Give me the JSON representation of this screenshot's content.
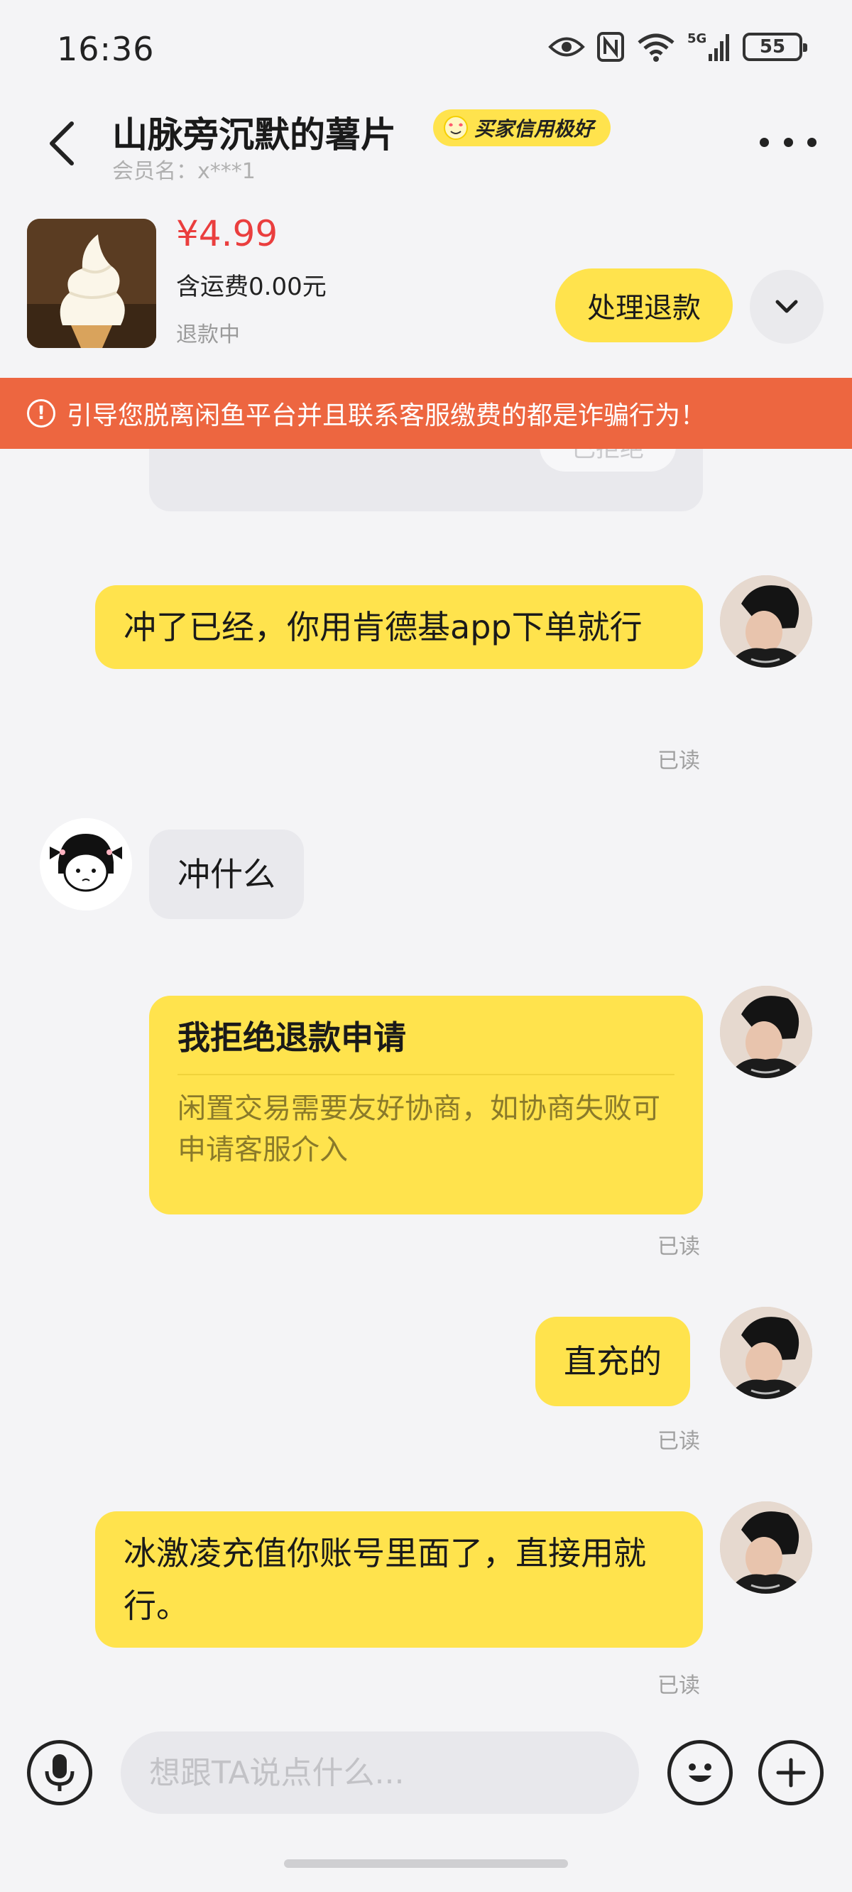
{
  "status_bar": {
    "time": "16:36",
    "network": "5G",
    "battery": "55",
    "icons": [
      "eye-icon",
      "nfc-icon",
      "wifi-icon",
      "signal-icon",
      "battery-icon"
    ]
  },
  "header": {
    "seller_name": "山脉旁沉默的薯片",
    "credit_badge": "买家信用极好",
    "member_id": "会员名：x***1"
  },
  "product": {
    "price": "¥4.99",
    "shipping": "含运费0.00元",
    "status": "退款中",
    "refund_button": "处理退款"
  },
  "warning": {
    "text": "引导您脱离闲鱼平台并且联系客服缴费的都是诈骗行为！"
  },
  "messages": [
    {
      "from": "me",
      "text": "冲了已经，你用肯德基app下单就行",
      "read": "已读"
    },
    {
      "from": "other",
      "text": "冲什么"
    },
    {
      "from": "me",
      "type": "card",
      "title": "我拒绝退款申请",
      "body": "闲置交易需要友好协商，如协商失败可申请客服介入",
      "read": "已读"
    },
    {
      "from": "me",
      "text": "直充的",
      "read": "已读"
    },
    {
      "from": "me",
      "text": "冰激凌充值你账号里面了，直接用就行。",
      "read": "已读"
    }
  ],
  "partial_card": {
    "button_text": "已拒绝"
  },
  "input": {
    "placeholder": "想跟TA说点什么..."
  },
  "colors": {
    "accent_yellow": "#ffe34d",
    "warning_orange": "#ed6640",
    "price_red": "#ea3e3e",
    "background": "#f4f4f6"
  }
}
